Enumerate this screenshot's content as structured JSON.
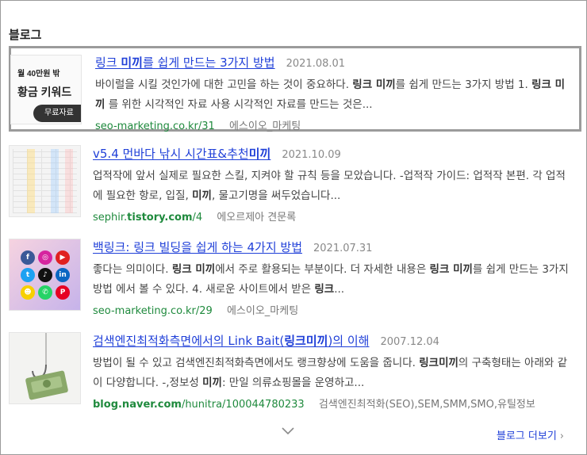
{
  "section_title": "블로그",
  "items": [
    {
      "title_parts": [
        "링크 ",
        "미끼",
        "를 쉽게 만드는 3가지 방법"
      ],
      "date": "2021.08.01",
      "desc_html": "바이럴을 시킬 것인가에 대한 고민을 하는 것이 중요하다. <b>링크 미끼</b>를 쉽게 만드는 3가지 방법 1. <b>링크 미끼</b> 를 위한 시각적인 자료 사용 시각적인 자료를 만드는 것은...",
      "url_html": "seo-marketing.co.kr/31",
      "source": "에스이오_마케팅",
      "thumb": {
        "line1": "월 40만원 밖",
        "line2": "황금 키워드",
        "pill": "무료자료"
      }
    },
    {
      "title_parts": [
        "v5.4 먼바다 낚시 시간표&추천",
        "미끼",
        ""
      ],
      "date": "2021.10.09",
      "desc_html": "업적작에 앞서 실제로 필요한 스킬, 지켜야 할 규칙 등을 모았습니다. -업적작 가이드: 업적작 본편. 각 업적에 필요한 항로, 입질, <b>미끼</b>, 물고기명을 써두었습니다...",
      "url_html": "sephir.<b>tistory.com</b>/4",
      "source": "에오르제아 견문록"
    },
    {
      "title_parts": [
        "백링크: 링크 빌딩을 쉽게 하는 4가지 방법",
        "",
        ""
      ],
      "date": "2021.07.31",
      "desc_html": "좋다는 의미이다. <b>링크 미끼</b>에서 주로 활용되는 부분이다. 더 자세한 내용은 <b>링크 미끼</b>를 쉽게 만드는 3가지 방법 에서 볼 수 있다. 4. 새로운 사이트에서 받은 <b>링크</b>...",
      "url_html": "seo-marketing.co.kr/29",
      "source": "에스이오_마케팅"
    },
    {
      "title_parts": [
        "검색엔진최적화측면에서의 Link Bait(",
        "링크미끼",
        ")의 이해"
      ],
      "date": "2007.12.04",
      "desc_html": "방법이 될 수 있고 검색엔진최적화측면에서도 랭크향상에 도움을 줍니다. <b>링크미끼</b>의 구축형태는 아래와 같이 다양합니다. -,정보성 <b>미끼</b>: 만일 의류쇼핑몰을 운영하고...",
      "url_html": "<b>blog.naver.com</b>/hunitra/100044780233",
      "source": "검색엔진최적화(SEO),SEM,SMM,SMO,유틸정보"
    }
  ],
  "more_label": "블로그 더보기",
  "colors": {
    "link": "#1f3fd8",
    "url": "#1f8a3d",
    "highlight_border": "#9b9b9b"
  }
}
